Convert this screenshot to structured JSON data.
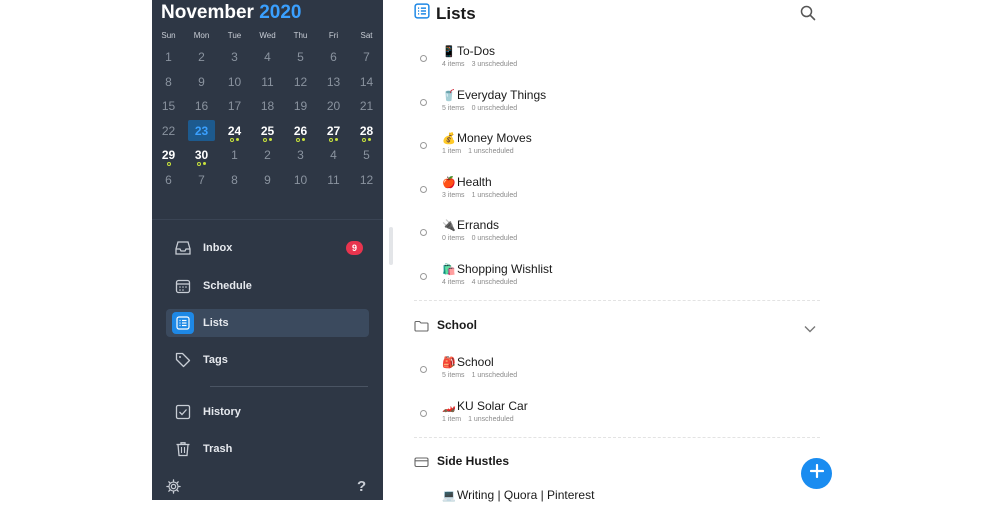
{
  "calendar": {
    "month": "November",
    "year": "2020",
    "weekdays": [
      "Sun",
      "Mon",
      "Tue",
      "Wed",
      "Thu",
      "Fri",
      "Sat"
    ],
    "weeks": [
      [
        "1",
        "2",
        "3",
        "4",
        "5",
        "6",
        "7"
      ],
      [
        "8",
        "9",
        "10",
        "11",
        "12",
        "13",
        "14"
      ],
      [
        "15",
        "16",
        "17",
        "18",
        "19",
        "20",
        "21"
      ],
      [
        "22",
        "23",
        "24",
        "25",
        "26",
        "27",
        "28"
      ],
      [
        "29",
        "30",
        "1",
        "2",
        "3",
        "4",
        "5"
      ],
      [
        "6",
        "7",
        "8",
        "9",
        "10",
        "11",
        "12"
      ]
    ],
    "today": "23",
    "accent_color": "#3aa0ff",
    "dot_color": "#c9e33c"
  },
  "nav": {
    "inbox": {
      "label": "Inbox",
      "badge": "9",
      "icon": "inbox-tray-icon"
    },
    "schedule": {
      "label": "Schedule",
      "icon": "calendar-icon"
    },
    "lists": {
      "label": "Lists",
      "icon": "list-icon"
    },
    "tags": {
      "label": "Tags",
      "icon": "tag-icon"
    },
    "history": {
      "label": "History",
      "icon": "checkbox-icon"
    },
    "trash": {
      "label": "Trash",
      "icon": "trash-icon"
    },
    "settings_icon": "gear-icon",
    "help_icon": "question-icon"
  },
  "main": {
    "title": "Lists",
    "search_icon": "search-icon",
    "lists": [
      {
        "emoji": "📱",
        "name": "To-Dos",
        "items": "4 items",
        "unscheduled": "3 unscheduled"
      },
      {
        "emoji": "🥤",
        "name": "Everyday Things",
        "items": "5 items",
        "unscheduled": "0 unscheduled"
      },
      {
        "emoji": "💰",
        "name": "Money Moves",
        "items": "1 item",
        "unscheduled": "1 unscheduled"
      },
      {
        "emoji": "🍎",
        "name": "Health",
        "items": "3 items",
        "unscheduled": "1 unscheduled"
      },
      {
        "emoji": "🔌",
        "name": "Errands",
        "items": "0 items",
        "unscheduled": "0 unscheduled"
      },
      {
        "emoji": "🛍️",
        "name": "Shopping Wishlist",
        "items": "4 items",
        "unscheduled": "4 unscheduled"
      }
    ],
    "folders": [
      {
        "name": "School",
        "lists": [
          {
            "emoji": "🎒",
            "name": "School",
            "items": "5 items",
            "unscheduled": "1 unscheduled"
          },
          {
            "emoji": "🏎️",
            "name": "KU Solar Car",
            "items": "1 item",
            "unscheduled": "1 unscheduled"
          }
        ]
      },
      {
        "name": "Side Hustles",
        "lists": [
          {
            "emoji": "💻",
            "name": "Writing | Quora | Pinterest"
          }
        ]
      }
    ],
    "fab_icon": "plus-icon",
    "fab_color": "#1a8cf0"
  }
}
